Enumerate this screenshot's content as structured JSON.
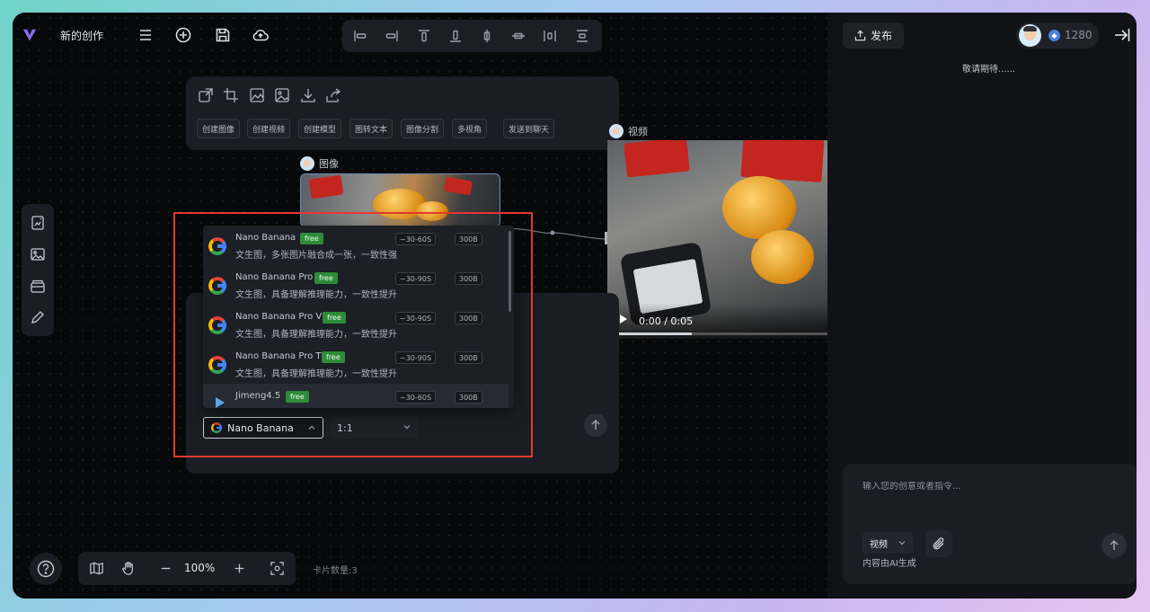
{
  "header": {
    "project_title": "新的创作",
    "icons": [
      "menu-icon",
      "add-icon",
      "save-icon",
      "cloud-icon"
    ]
  },
  "align_toolbar": {
    "icons": [
      "align-left-icon",
      "align-right-icon",
      "align-top-icon",
      "align-bottom-icon",
      "align-center-horizontal-icon",
      "align-center-vertical-icon",
      "distribute-horizontal-icon",
      "distribute-vertical-icon"
    ]
  },
  "node_toolbar": {
    "icons": [
      "upscale-icon",
      "crop-icon",
      "enhance-icon",
      "image-edit-icon",
      "download-icon",
      "share-icon"
    ],
    "actions": [
      "创建图像",
      "创建视频",
      "创建模型",
      "图转文本",
      "图像分割",
      "多视角",
      "发送到聊天"
    ]
  },
  "image_node": {
    "label": "图像"
  },
  "video_node": {
    "label": "视频",
    "time": "0:00 / 0:05",
    "progress": 0.35
  },
  "model_dropdown": {
    "items": [
      {
        "name": "Nano Banana",
        "tag": "free",
        "time": "~30-60S",
        "cost": "300B",
        "desc": "文生图，多张图片融合成一张，一致性强",
        "logo": "google-icon"
      },
      {
        "name": "Nano Banana Pro",
        "tag": "free",
        "time": "~30-90S",
        "cost": "300B",
        "desc": "文生图，具备理解推理能力，一致性提升",
        "logo": "google-icon"
      },
      {
        "name": "Nano Banana Pro V",
        "tag": "free",
        "time": "~30-90S",
        "cost": "300B",
        "desc": "文生图，具备理解推理能力，一致性提升",
        "logo": "google-icon"
      },
      {
        "name": "Nano Banana Pro T",
        "tag": "free",
        "time": "~30-90S",
        "cost": "300B",
        "desc": "文生图，具备理解推理能力，一致性提升",
        "logo": "google-icon"
      },
      {
        "name": "Jimeng4.5",
        "tag": "free",
        "time": "~30-60S",
        "cost": "300B",
        "desc": "",
        "logo": "jimeng-icon"
      }
    ]
  },
  "prompt_panel": {
    "selected_model": "Nano Banana",
    "aspect_ratio": "1:1"
  },
  "left_tools": [
    "image-card-icon",
    "image-add-icon",
    "layers-icon",
    "pencil-icon"
  ],
  "bottom_bar": {
    "zoom": "100%",
    "card_count": "卡片数量:3"
  },
  "right_panel": {
    "publish_label": "发布",
    "credits": "1280",
    "coming_soon": "敬请期待......",
    "chat_placeholder": "输入您的创意或者指令...",
    "mode": "视频",
    "ai_note": "内容由AI生成"
  },
  "colors": {
    "accent_free": "#2e8b3a",
    "highlight": "#e23a2e",
    "panel": "#1a1d24"
  }
}
